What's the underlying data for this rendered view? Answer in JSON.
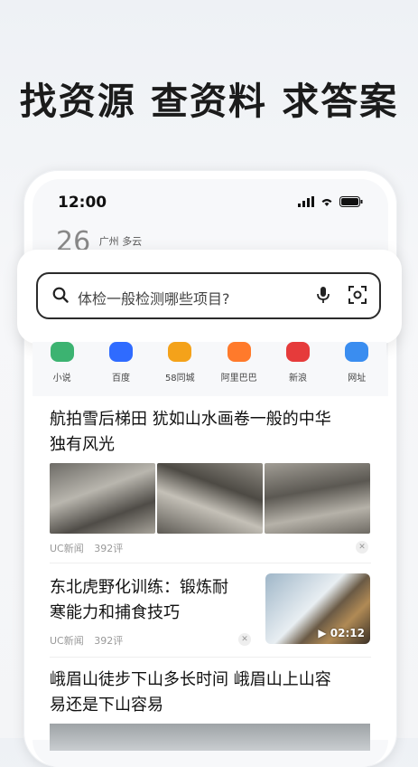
{
  "headline": "找资源 查资料 求答案",
  "status_bar": {
    "time": "12:00"
  },
  "weather": {
    "temp": "26",
    "city": "广州",
    "condition": "多云"
  },
  "search": {
    "placeholder": "体检一般检测哪些项目?"
  },
  "quick_links": [
    {
      "label": "小说",
      "icon": "novel-icon",
      "color": "#3cb371"
    },
    {
      "label": "百度",
      "icon": "baidu-icon",
      "color": "#2f6bff"
    },
    {
      "label": "58同城",
      "icon": "58-icon",
      "color": "#f4a21a"
    },
    {
      "label": "阿里巴巴",
      "icon": "alibaba-icon",
      "color": "#ff7a2b"
    },
    {
      "label": "新浪",
      "icon": "sina-icon",
      "color": "#e63b3b"
    },
    {
      "label": "网址",
      "icon": "globe-icon",
      "color": "#3a8df0"
    }
  ],
  "articles": [
    {
      "title_line1": "航拍雪后梯田 犹如山水画卷一般的中华",
      "title_line2": "独有风光",
      "source": "UC新闻",
      "comments": "392评"
    },
    {
      "title_line1": "东北虎野化训练：锻炼耐",
      "title_line2": "寒能力和捕食技巧",
      "source": "UC新闻",
      "comments": "392评",
      "duration": "▶ 02:12"
    },
    {
      "title_line1": "峨眉山徒步下山多长时间 峨眉山上山容",
      "title_line2": "易还是下山容易"
    }
  ]
}
